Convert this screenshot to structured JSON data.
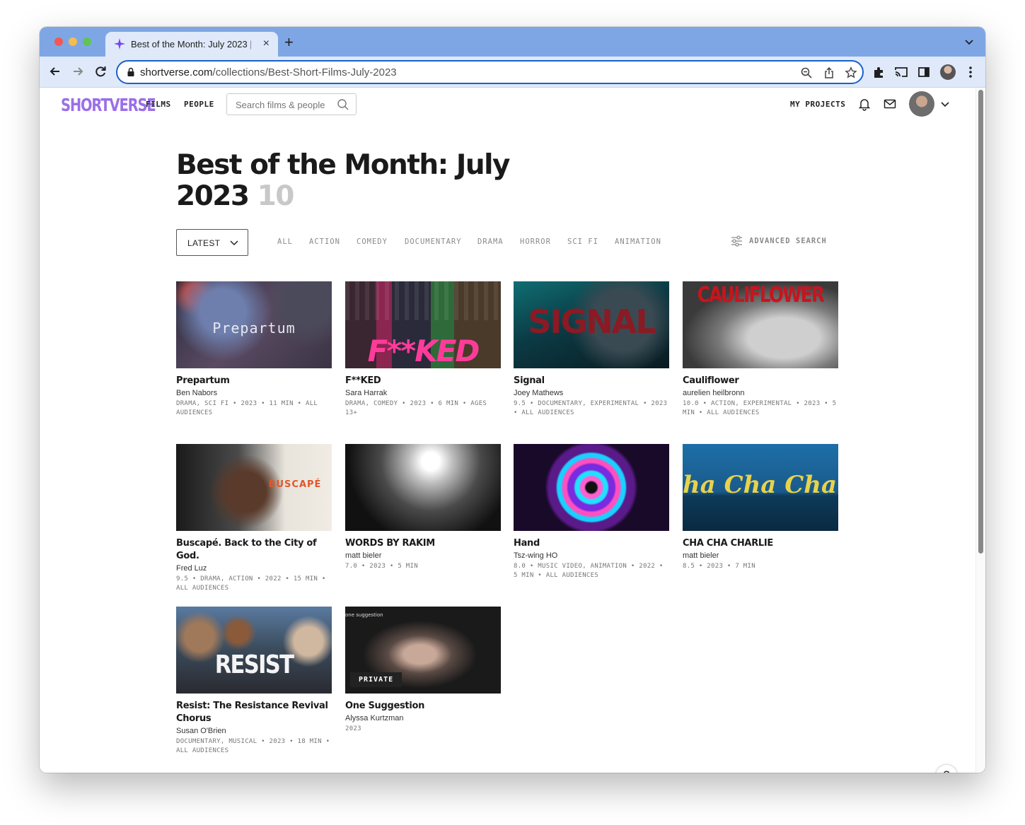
{
  "browser": {
    "tab_title": "Best of the Month: July 2023 |",
    "url_host": "shortverse.com",
    "url_path": "/collections/Best-Short-Films-July-2023"
  },
  "site": {
    "logo": "SHORTVERSE",
    "nav_films": "FILMS",
    "nav_people": "PEOPLE",
    "search_placeholder": "Search films & people",
    "my_projects": "MY PROJECTS"
  },
  "collection": {
    "title": "Best of the Month: July 2023",
    "count": "10"
  },
  "filters": {
    "sort_value": "LATEST",
    "genres": [
      "ALL",
      "ACTION",
      "COMEDY",
      "DOCUMENTARY",
      "DRAMA",
      "HORROR",
      "SCI FI",
      "ANIMATION"
    ],
    "advanced_search": "ADVANCED SEARCH"
  },
  "films": [
    {
      "title": "Prepartum",
      "author": "Ben Nabors",
      "meta": "DRAMA, SCI FI • 2023 • 11 MIN • ALL AUDIENCES",
      "thumb_text": "Prepartum"
    },
    {
      "title": "F**KED",
      "author": "Sara Harrak",
      "meta": "DRAMA, COMEDY • 2023 • 6 MIN • AGES 13+",
      "thumb_text": "F**KED"
    },
    {
      "title": "Signal",
      "author": "Joey Mathews",
      "meta": "9.5 • DOCUMENTARY, EXPERIMENTAL • 2023 • ALL AUDIENCES",
      "thumb_text": "SIGNAL"
    },
    {
      "title": "Cauliflower",
      "author": "aurelien heilbronn",
      "meta": "10.0 • ACTION, EXPERIMENTAL • 2023 • 5 MIN • ALL AUDIENCES",
      "thumb_text": "CAULIFLOWER"
    },
    {
      "title": "Buscapé. Back to the City of God.",
      "author": "Fred Luz",
      "meta": "9.5 • DRAMA, ACTION • 2022 • 15 MIN • ALL AUDIENCES",
      "thumb_text": "BUSCAPÉ"
    },
    {
      "title": "WORDS BY RAKIM",
      "author": "matt bieler",
      "meta": "7.0 • 2023 • 5 MIN",
      "thumb_text": ""
    },
    {
      "title": "Hand",
      "author": "Tsz-wing HO",
      "meta": "8.0 • MUSIC VIDEO, ANIMATION • 2022 • 5 MIN • ALL AUDIENCES",
      "thumb_text": ""
    },
    {
      "title": "CHA CHA CHARLIE",
      "author": "matt bieler",
      "meta": "8.5 • 2023 • 7 MIN",
      "thumb_text": "ha Cha Char"
    },
    {
      "title": "Resist: The Resistance Revival Chorus",
      "author": "Susan O'Brien",
      "meta": "DOCUMENTARY, MUSICAL • 2023 • 18 MIN • ALL AUDIENCES",
      "thumb_text": "RESIST"
    },
    {
      "title": "One Suggestion",
      "author": "Alyssa Kurtzman",
      "meta": "2023",
      "thumb_text": "one suggestion",
      "badge": "PRIVATE"
    }
  ],
  "help_label": "?",
  "icons": [
    "sparkle-icon",
    "close-icon",
    "plus-icon",
    "chevron-down-icon",
    "back-arrow-icon",
    "forward-arrow-icon",
    "reload-icon",
    "lock-icon",
    "zoom-icon",
    "share-icon",
    "star-icon",
    "extensions-icon",
    "cast-icon",
    "sidepanel-icon",
    "kebab-icon",
    "search-icon",
    "bell-icon",
    "mail-icon",
    "sliders-icon"
  ]
}
